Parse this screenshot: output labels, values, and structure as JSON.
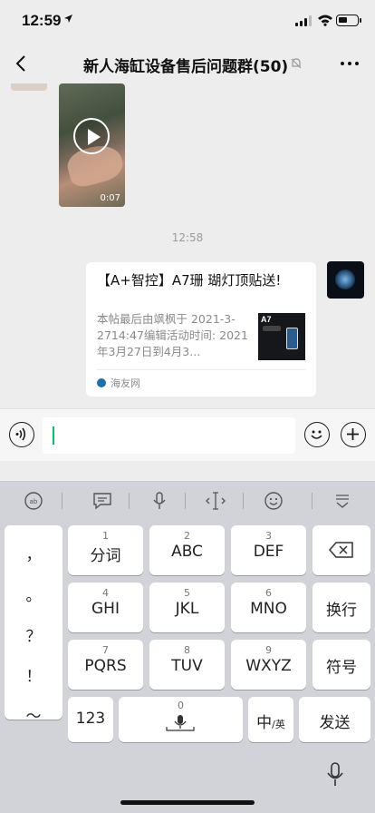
{
  "status": {
    "time": "12:59"
  },
  "nav": {
    "title": "新人海缸设备售后问题群(50)"
  },
  "chat": {
    "video": {
      "duration": "0:07"
    },
    "timestamp": "12:58",
    "card": {
      "title": "【A+智控】A7珊 瑚灯顶贴送!",
      "desc": "本帖最后由飒枫于 2021-3-2714:47编辑活动时间: 2021年3月27日到4月3...",
      "thumb_text": "A7",
      "source": "海友网"
    }
  },
  "input": {
    "value": "",
    "placeholder": ""
  },
  "ime_tools": [
    "emoji-pad-icon",
    "clipboard-icon",
    "mic-icon",
    "cursor-icon",
    "smile-icon",
    "hide-keyboard-icon"
  ],
  "keyboard": {
    "symbols": [
      "，",
      "。",
      "？",
      "！",
      "～"
    ],
    "keys": [
      {
        "num": "1",
        "label": "分词"
      },
      {
        "num": "2",
        "label": "ABC"
      },
      {
        "num": "3",
        "label": "DEF"
      },
      {
        "num": "4",
        "label": "GHI"
      },
      {
        "num": "5",
        "label": "JKL"
      },
      {
        "num": "6",
        "label": "MNO"
      },
      {
        "num": "7",
        "label": "PQRS"
      },
      {
        "num": "8",
        "label": "TUV"
      },
      {
        "num": "9",
        "label": "WXYZ"
      }
    ],
    "newline": "换行",
    "symbol_key": "符号",
    "num_key": "123",
    "space_num": "0",
    "lang_key": "中",
    "lang_sub": "/英",
    "send": "发送"
  }
}
